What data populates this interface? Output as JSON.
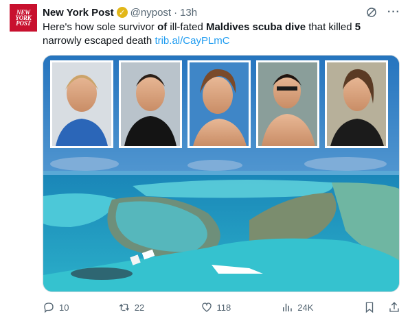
{
  "tweet": {
    "author_name": "New York Post",
    "handle": "@nypost",
    "separator": "·",
    "time": "13h",
    "text": {
      "p1": "Here's how sole survivor ",
      "b1": "of",
      "p2": " ill-fated ",
      "b2": "Maldives scuba dive",
      "p3": " that killed ",
      "b3": "5",
      "p4": " narrowly escaped death ",
      "link": "trib.al/CayPLmC"
    },
    "avatar_lines": [
      "NEW",
      "YORK",
      "POST"
    ]
  },
  "actions": {
    "replies": "10",
    "reposts": "22",
    "likes": "118",
    "views": "24K"
  },
  "colors": {
    "brand_red": "#c8102e",
    "link_blue": "#1d9bf0",
    "muted": "#536471",
    "ocean_deep": "#0f4f86",
    "lagoon": "#4cc8d8"
  },
  "icons": [
    "verified-badge-icon",
    "grok-icon",
    "more-icon",
    "reply-icon",
    "repost-icon",
    "like-icon",
    "views-icon",
    "bookmark-icon",
    "share-icon"
  ]
}
